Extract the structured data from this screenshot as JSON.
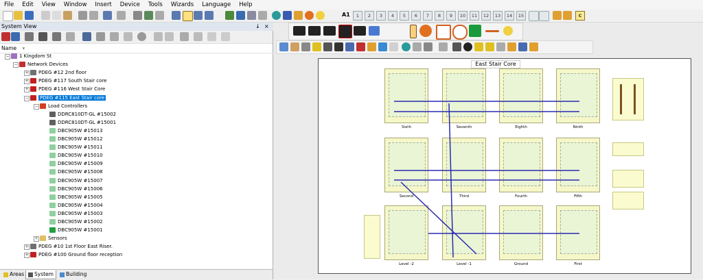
{
  "menubar": {
    "items": [
      "File",
      "Edit",
      "View",
      "Window",
      "Insert",
      "Device",
      "Tools",
      "Wizards",
      "Language",
      "Help"
    ]
  },
  "toolbar": {
    "a1_label": "A1",
    "numbers": [
      "1",
      "2",
      "3",
      "4",
      "5",
      "6",
      "7",
      "8",
      "9",
      "10",
      "11",
      "12",
      "13",
      "14",
      "15"
    ],
    "c_label": "C"
  },
  "system_view": {
    "title": "System View",
    "pin": "↓",
    "close": "×",
    "column_header": "Name",
    "tree": [
      {
        "label": "1 Kingdom St",
        "level": 0,
        "icon": "site"
      },
      {
        "label": "Network Devices",
        "level": 1,
        "icon": "network"
      },
      {
        "label": "PDEG #12 2nd floor",
        "level": 2,
        "icon": "pdeg"
      },
      {
        "label": "PDEG #117 South Stair core",
        "level": 2,
        "icon": "pdeg-red"
      },
      {
        "label": "PDEG #116 West Stair Core",
        "level": 2,
        "icon": "pdeg-red"
      },
      {
        "label": "PDEG #115 East Stair core",
        "level": 2,
        "icon": "pdeg-red",
        "selected": true
      },
      {
        "label": "Load Controllers",
        "level": 3,
        "icon": "folder-red"
      },
      {
        "label": "DDRC810DT-GL #15002",
        "level": 4,
        "icon": "rc"
      },
      {
        "label": "DDRC810DT-GL #15001",
        "level": 4,
        "icon": "rc"
      },
      {
        "label": "DBC905W #15013",
        "level": 4,
        "icon": "dbc"
      },
      {
        "label": "DBC905W #15012",
        "level": 4,
        "icon": "dbc"
      },
      {
        "label": "DBC905W #15011",
        "level": 4,
        "icon": "dbc"
      },
      {
        "label": "DBC905W #15010",
        "level": 4,
        "icon": "dbc"
      },
      {
        "label": "DBC905W #15009",
        "level": 4,
        "icon": "dbc"
      },
      {
        "label": "DBC905W #15008",
        "level": 4,
        "icon": "dbc"
      },
      {
        "label": "DBC905W #15007",
        "level": 4,
        "icon": "dbc"
      },
      {
        "label": "DBC905W #15006",
        "level": 4,
        "icon": "dbc"
      },
      {
        "label": "DBC905W #15005",
        "level": 4,
        "icon": "dbc"
      },
      {
        "label": "DBC905W #15004",
        "level": 4,
        "icon": "dbc"
      },
      {
        "label": "DBC905W #15003",
        "level": 4,
        "icon": "dbc"
      },
      {
        "label": "DBC905W #15002",
        "level": 4,
        "icon": "dbc"
      },
      {
        "label": "DBC905W #15001",
        "level": 4,
        "icon": "dbc-play"
      },
      {
        "label": "Sensors",
        "level": 3,
        "icon": "folder"
      },
      {
        "label": "PDEG #10 1st Floor East Riser.",
        "level": 2,
        "icon": "pdeg"
      },
      {
        "label": "PDEG #100 Ground floor reception",
        "level": 2,
        "icon": "pdeg-red"
      }
    ]
  },
  "bottom_tabs": [
    "Areas",
    "System",
    "Building"
  ],
  "canvas": {
    "title": "East Stair Core",
    "floors": [
      "Sixth",
      "Seventh",
      "Eighth",
      "Ninth",
      "Second",
      "Third",
      "Fourth",
      "Fifth",
      "Level -2",
      "Level -1",
      "Ground",
      "First"
    ]
  },
  "colors": {
    "selection": "#0078d7",
    "floor_fill": "#f6f7c8",
    "wire": "#2a2ab0"
  }
}
